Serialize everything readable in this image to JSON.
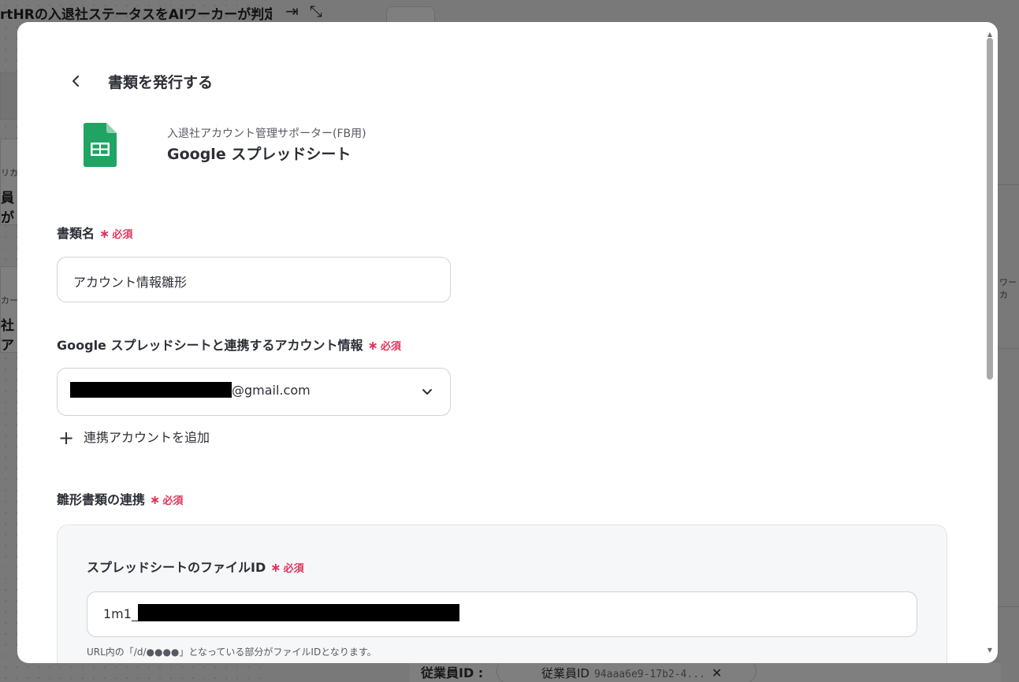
{
  "background": {
    "workflow_title": "rtHRの入退社ステータスをAIワーカーが判定",
    "card1_tag": "リカ",
    "card1_text": "員が",
    "card2_tag": "カー",
    "card2_text": "社ア",
    "right_text": "ワーカ",
    "bottom_label": "従業員ID :",
    "bottom_chip_label": "従業員ID",
    "bottom_chip_value": "94aaa6e9-17b2-4...",
    "bottom_chip_close": "✕"
  },
  "header": {
    "title": "書類を発行する"
  },
  "app": {
    "subtitle": "入退社アカウント管理サポーター(FB用)",
    "name": "Google スプレッドシート"
  },
  "fields": {
    "doc_name": {
      "label": "書類名",
      "required": "必須",
      "value": "アカウント情報雛形"
    },
    "account": {
      "label": "Google スプレッドシートと連携するアカウント情報",
      "required": "必須",
      "value_suffix": "@gmail.com"
    },
    "add_account": "連携アカウントを追加",
    "template": {
      "label": "雛形書類の連携",
      "required": "必須"
    },
    "file_id": {
      "label": "スプレッドシートのファイルID",
      "required": "必須",
      "value_prefix": "1m1_",
      "hint": "URL内の「/d/●●●●」となっている部分がファイルIDとなります。"
    }
  },
  "colors": {
    "required": "#e0355a",
    "sheets_green": "#1fa463"
  }
}
